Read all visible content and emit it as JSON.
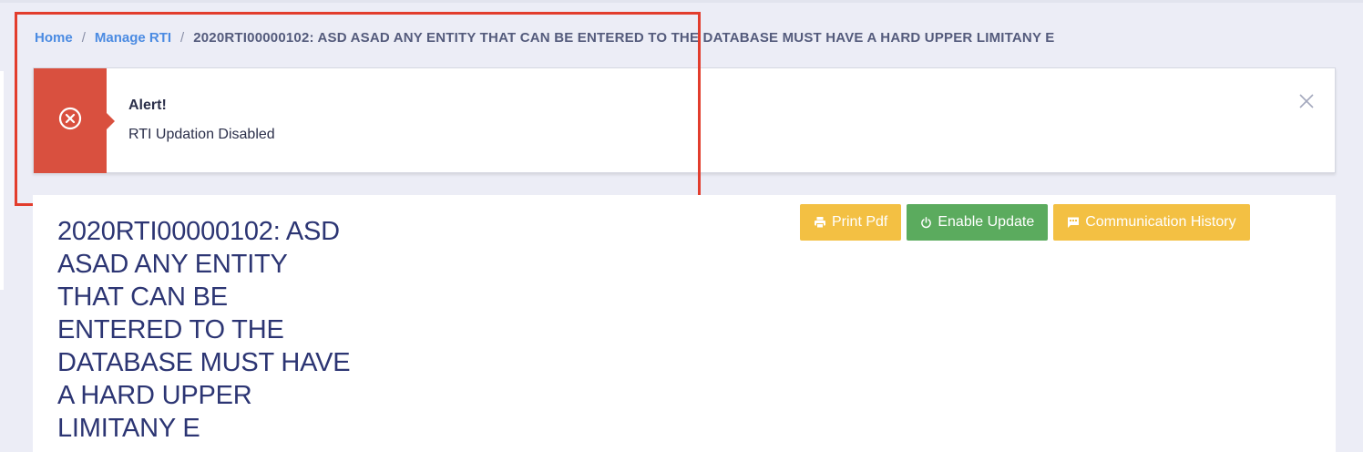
{
  "breadcrumb": {
    "home": "Home",
    "separator": "/",
    "manage_rti": "Manage RTI",
    "current": "2020RTI00000102: ASD ASAD ANY ENTITY THAT CAN BE ENTERED TO THE DATABASE MUST HAVE A HARD UPPER LIMITANY E"
  },
  "alert": {
    "icon": "x-circle-icon",
    "title": "Alert!",
    "message": "RTI Updation Disabled",
    "close_icon": "close-icon",
    "color": "#d9503f"
  },
  "record": {
    "title": "2020RTI00000102: ASD ASAD ANY ENTITY THAT CAN BE ENTERED TO THE DATABASE MUST HAVE A HARD UPPER LIMITANY E"
  },
  "actions": {
    "print_pdf": {
      "label": "Print Pdf",
      "icon": "printer-icon",
      "color": "#f3c043"
    },
    "enable_update": {
      "label": "Enable Update",
      "icon": "power-icon",
      "color": "#5bab5e"
    },
    "communication_history": {
      "label": "Communication History",
      "icon": "message-icon",
      "color": "#f3c043"
    }
  },
  "colors": {
    "highlight": "#e23d2d",
    "link": "#4b8be2",
    "title": "#2c3573"
  }
}
